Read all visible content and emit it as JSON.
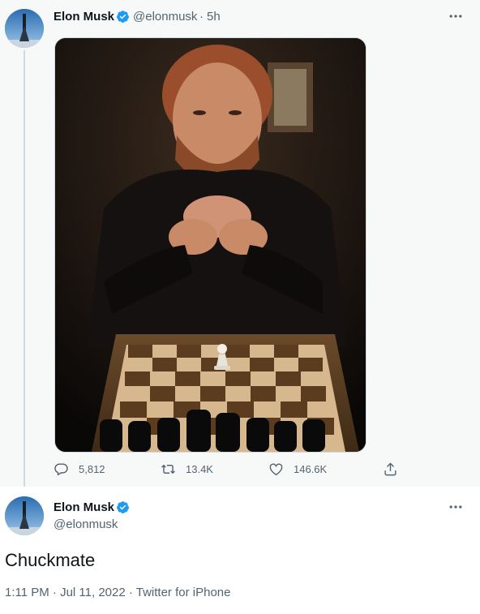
{
  "colors": {
    "verified": "#1d9bf0",
    "secondary_text": "#536471",
    "primary_text": "#0f1419",
    "thread_line": "#cfd9de"
  },
  "reply_tweet": {
    "author_name": "Elon Musk",
    "handle": "@elonmusk",
    "separator": "·",
    "time": "5h",
    "more_icon": "more-icon",
    "media_description_icon": "image",
    "actions": {
      "reply_count": "5,812",
      "retweet_count": "13.4K",
      "like_count": "146.6K"
    }
  },
  "main_tweet": {
    "author_name": "Elon Musk",
    "handle": "@elonmusk",
    "text": "Chuckmate",
    "meta": "1:11 PM · Jul 11, 2022 · Twitter for iPhone"
  }
}
